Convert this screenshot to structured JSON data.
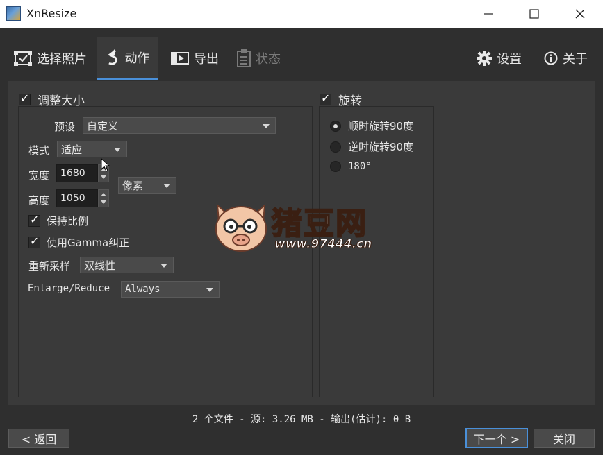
{
  "window": {
    "title": "XnResize"
  },
  "toolbar": {
    "tabs": [
      {
        "label": "选择照片",
        "icon": "select-photo-icon"
      },
      {
        "label": "动作",
        "icon": "action-icon"
      },
      {
        "label": "导出",
        "icon": "export-icon"
      },
      {
        "label": "状态",
        "icon": "status-icon"
      }
    ],
    "settings_label": "设置",
    "about_label": "关于"
  },
  "resize": {
    "title": "调整大小",
    "preset_label": "预设",
    "preset_value": "自定义",
    "mode_label": "模式",
    "mode_value": "适应",
    "width_label": "宽度",
    "width_value": "1680",
    "height_label": "高度",
    "height_value": "1050",
    "unit_value": "像素",
    "keep_ratio_label": "保持比例",
    "gamma_label": "使用Gamma纠正",
    "resample_label": "重新采样",
    "resample_value": "双线性",
    "enlarge_label": "Enlarge/Reduce",
    "enlarge_value": "Always"
  },
  "rotate": {
    "title": "旋转",
    "options": [
      "顺时旋转90度",
      "逆时旋转90度",
      "180°"
    ],
    "selected_index": 0
  },
  "watermark": {
    "text": "猪豆网",
    "url": "www.97444.cn"
  },
  "status_text": "2 个文件 - 源: 3.26 MB - 输出(估计): 0 B",
  "footer": {
    "back_label": "< 返回",
    "next_label": "下一个 >",
    "close_label": "关闭"
  },
  "colors": {
    "accent": "#4a90d9",
    "background": "#2f2f2f",
    "panel": "#3a3a3a"
  }
}
